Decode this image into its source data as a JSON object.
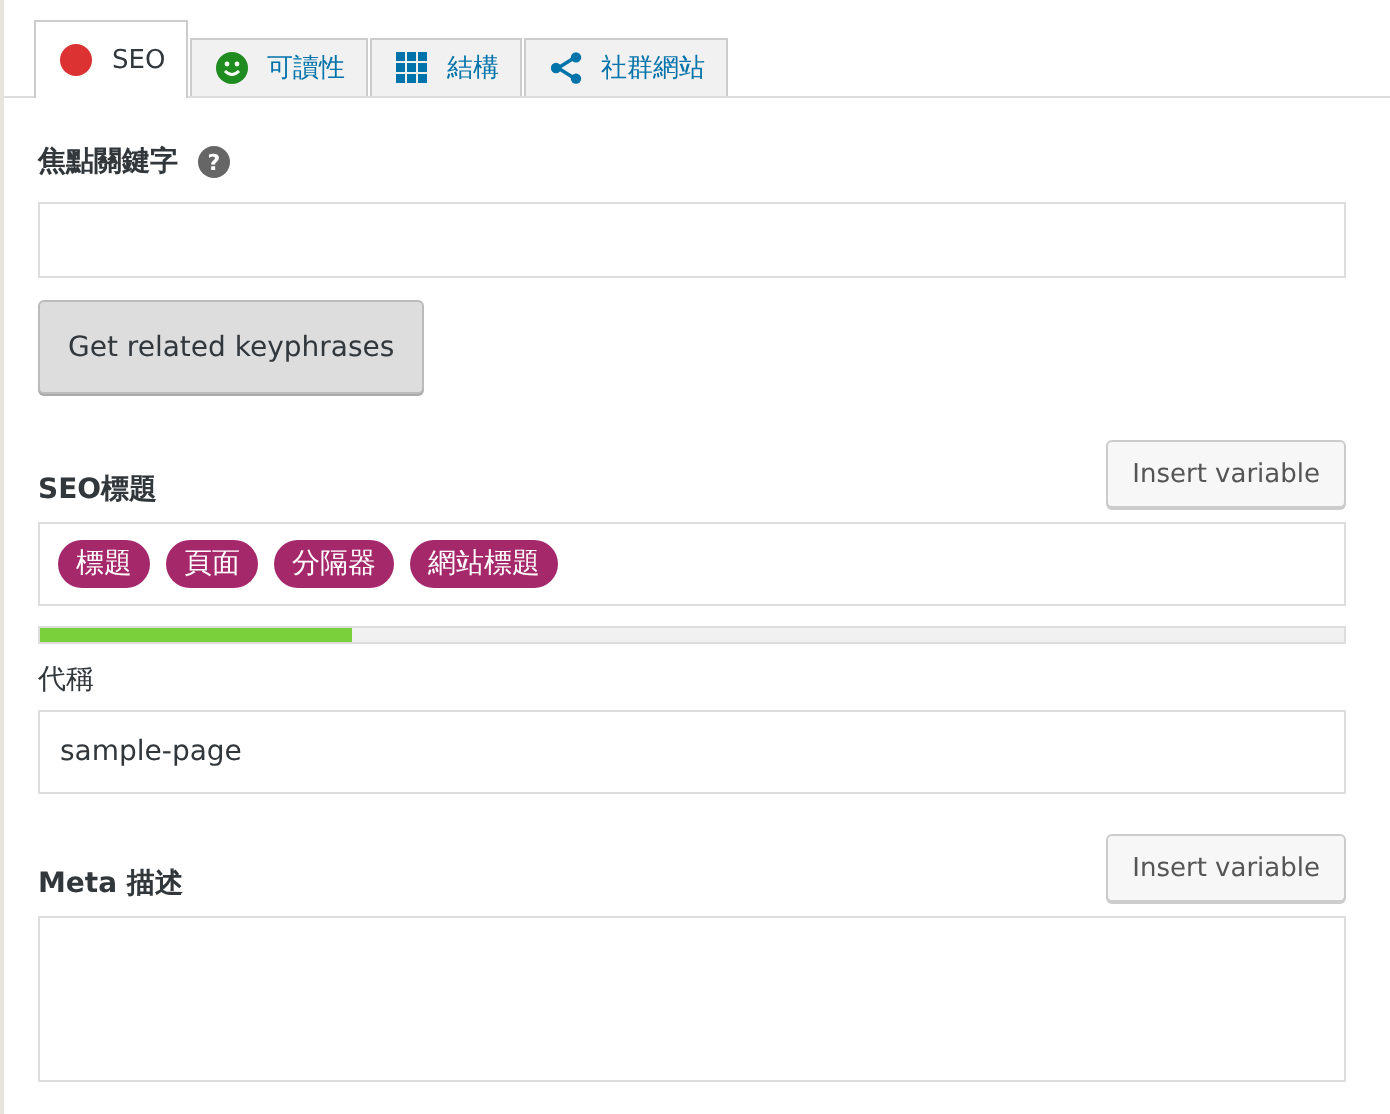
{
  "tabs": [
    {
      "label": "SEO",
      "kind": "dot",
      "color": "#dc3232",
      "selected": true
    },
    {
      "label": "可讀性",
      "kind": "smiley",
      "color": "#1e8c1e",
      "selected": false
    },
    {
      "label": "結構",
      "kind": "grid",
      "color": "#0073aa",
      "selected": false
    },
    {
      "label": "社群網站",
      "kind": "share",
      "color": "#0073aa",
      "selected": false
    }
  ],
  "focus_keyphrase": {
    "label": "焦點關鍵字",
    "help": "?",
    "button": "Get related keyphrases"
  },
  "seo_title": {
    "label": "SEO標題",
    "insert_button": "Insert variable",
    "tags": [
      "標題",
      "頁面",
      "分隔器",
      "網站標題"
    ],
    "level": 0.24
  },
  "slug": {
    "label": "代稱",
    "value": "sample-page"
  },
  "meta_description": {
    "label": "Meta 描述",
    "insert_button": "Insert variable"
  }
}
